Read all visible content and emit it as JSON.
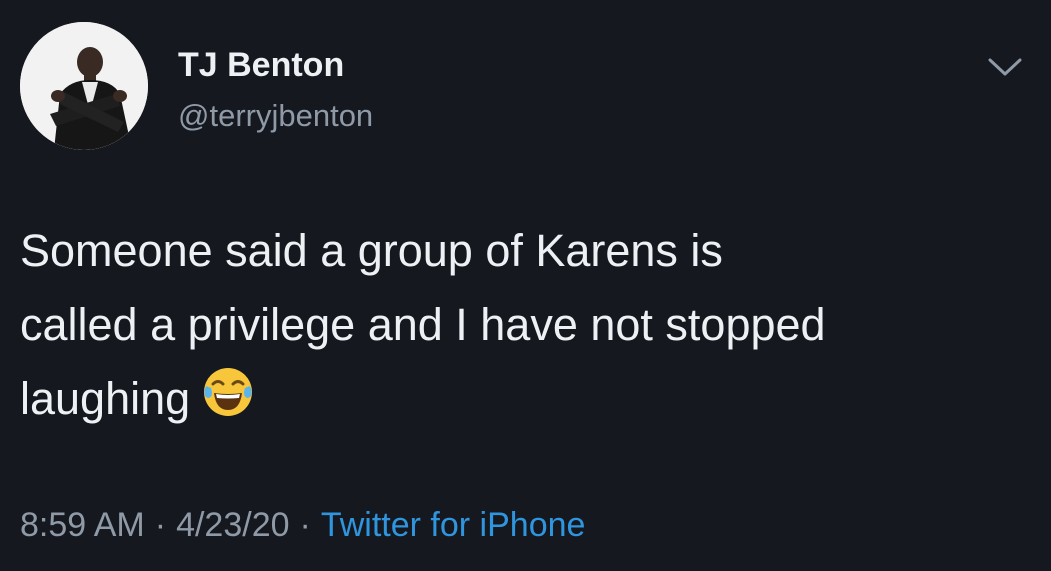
{
  "user": {
    "display_name": "TJ Benton",
    "handle": "@terryjbenton"
  },
  "tweet": {
    "lines": [
      "Someone said a group of Karens is",
      "called a privilege and I have not stopped",
      "laughing"
    ],
    "emoji": "face-with-tears-of-joy"
  },
  "meta": {
    "time": "8:59 AM",
    "separator": "·",
    "date": "4/23/20",
    "source": "Twitter for iPhone"
  },
  "colors": {
    "background": "#15181f",
    "text": "#eef1f4",
    "secondary": "#8f9aa6",
    "link": "#2f95de"
  },
  "icons": {
    "menu": "chevron-down-icon"
  }
}
